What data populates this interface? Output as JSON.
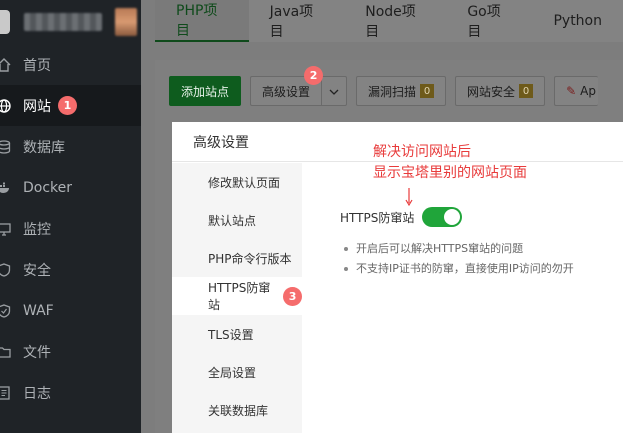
{
  "sidebar": {
    "items": [
      {
        "label": "首页",
        "icon": "home-icon"
      },
      {
        "label": "网站",
        "icon": "globe-icon",
        "badge": "1",
        "active": true
      },
      {
        "label": "数据库",
        "icon": "database-icon"
      },
      {
        "label": "Docker",
        "icon": "docker-icon"
      },
      {
        "label": "监控",
        "icon": "monitor-icon"
      },
      {
        "label": "安全",
        "icon": "shield-icon"
      },
      {
        "label": "WAF",
        "icon": "waf-shield-icon"
      },
      {
        "label": "文件",
        "icon": "folder-icon"
      },
      {
        "label": "日志",
        "icon": "log-icon"
      }
    ]
  },
  "tabs": [
    "PHP项目",
    "Java项目",
    "Node项目",
    "Go项目",
    "Python"
  ],
  "toolbar": {
    "add_site": "添加站点",
    "advanced": "高级设置",
    "advanced_badge": "2",
    "vuln_scan": "漏洞扫描",
    "vuln_count": "0",
    "site_security": "网站安全",
    "security_count": "0",
    "app_partial": "Ap"
  },
  "dialog": {
    "title": "高级设置",
    "menu": [
      {
        "label": "修改默认页面"
      },
      {
        "label": "默认站点"
      },
      {
        "label": "PHP命令行版本"
      },
      {
        "label": "HTTPS防窜站",
        "badge": "3",
        "active": true
      },
      {
        "label": "TLS设置"
      },
      {
        "label": "全局设置"
      },
      {
        "label": "关联数据库"
      }
    ],
    "toggle_label": "HTTPS防窜站",
    "tips": [
      "开启后可以解决HTTPS窜站的问题",
      "不支持IP证书的防窜，直接使用IP访问的勿开"
    ]
  },
  "annotation": {
    "line1": "解决访问网站后",
    "line2": "显示宝塔里别的网站页面"
  },
  "colors": {
    "accent_green": "#20a53a",
    "badge_red": "#f56c6c",
    "annotation_red": "#e83b3b"
  }
}
